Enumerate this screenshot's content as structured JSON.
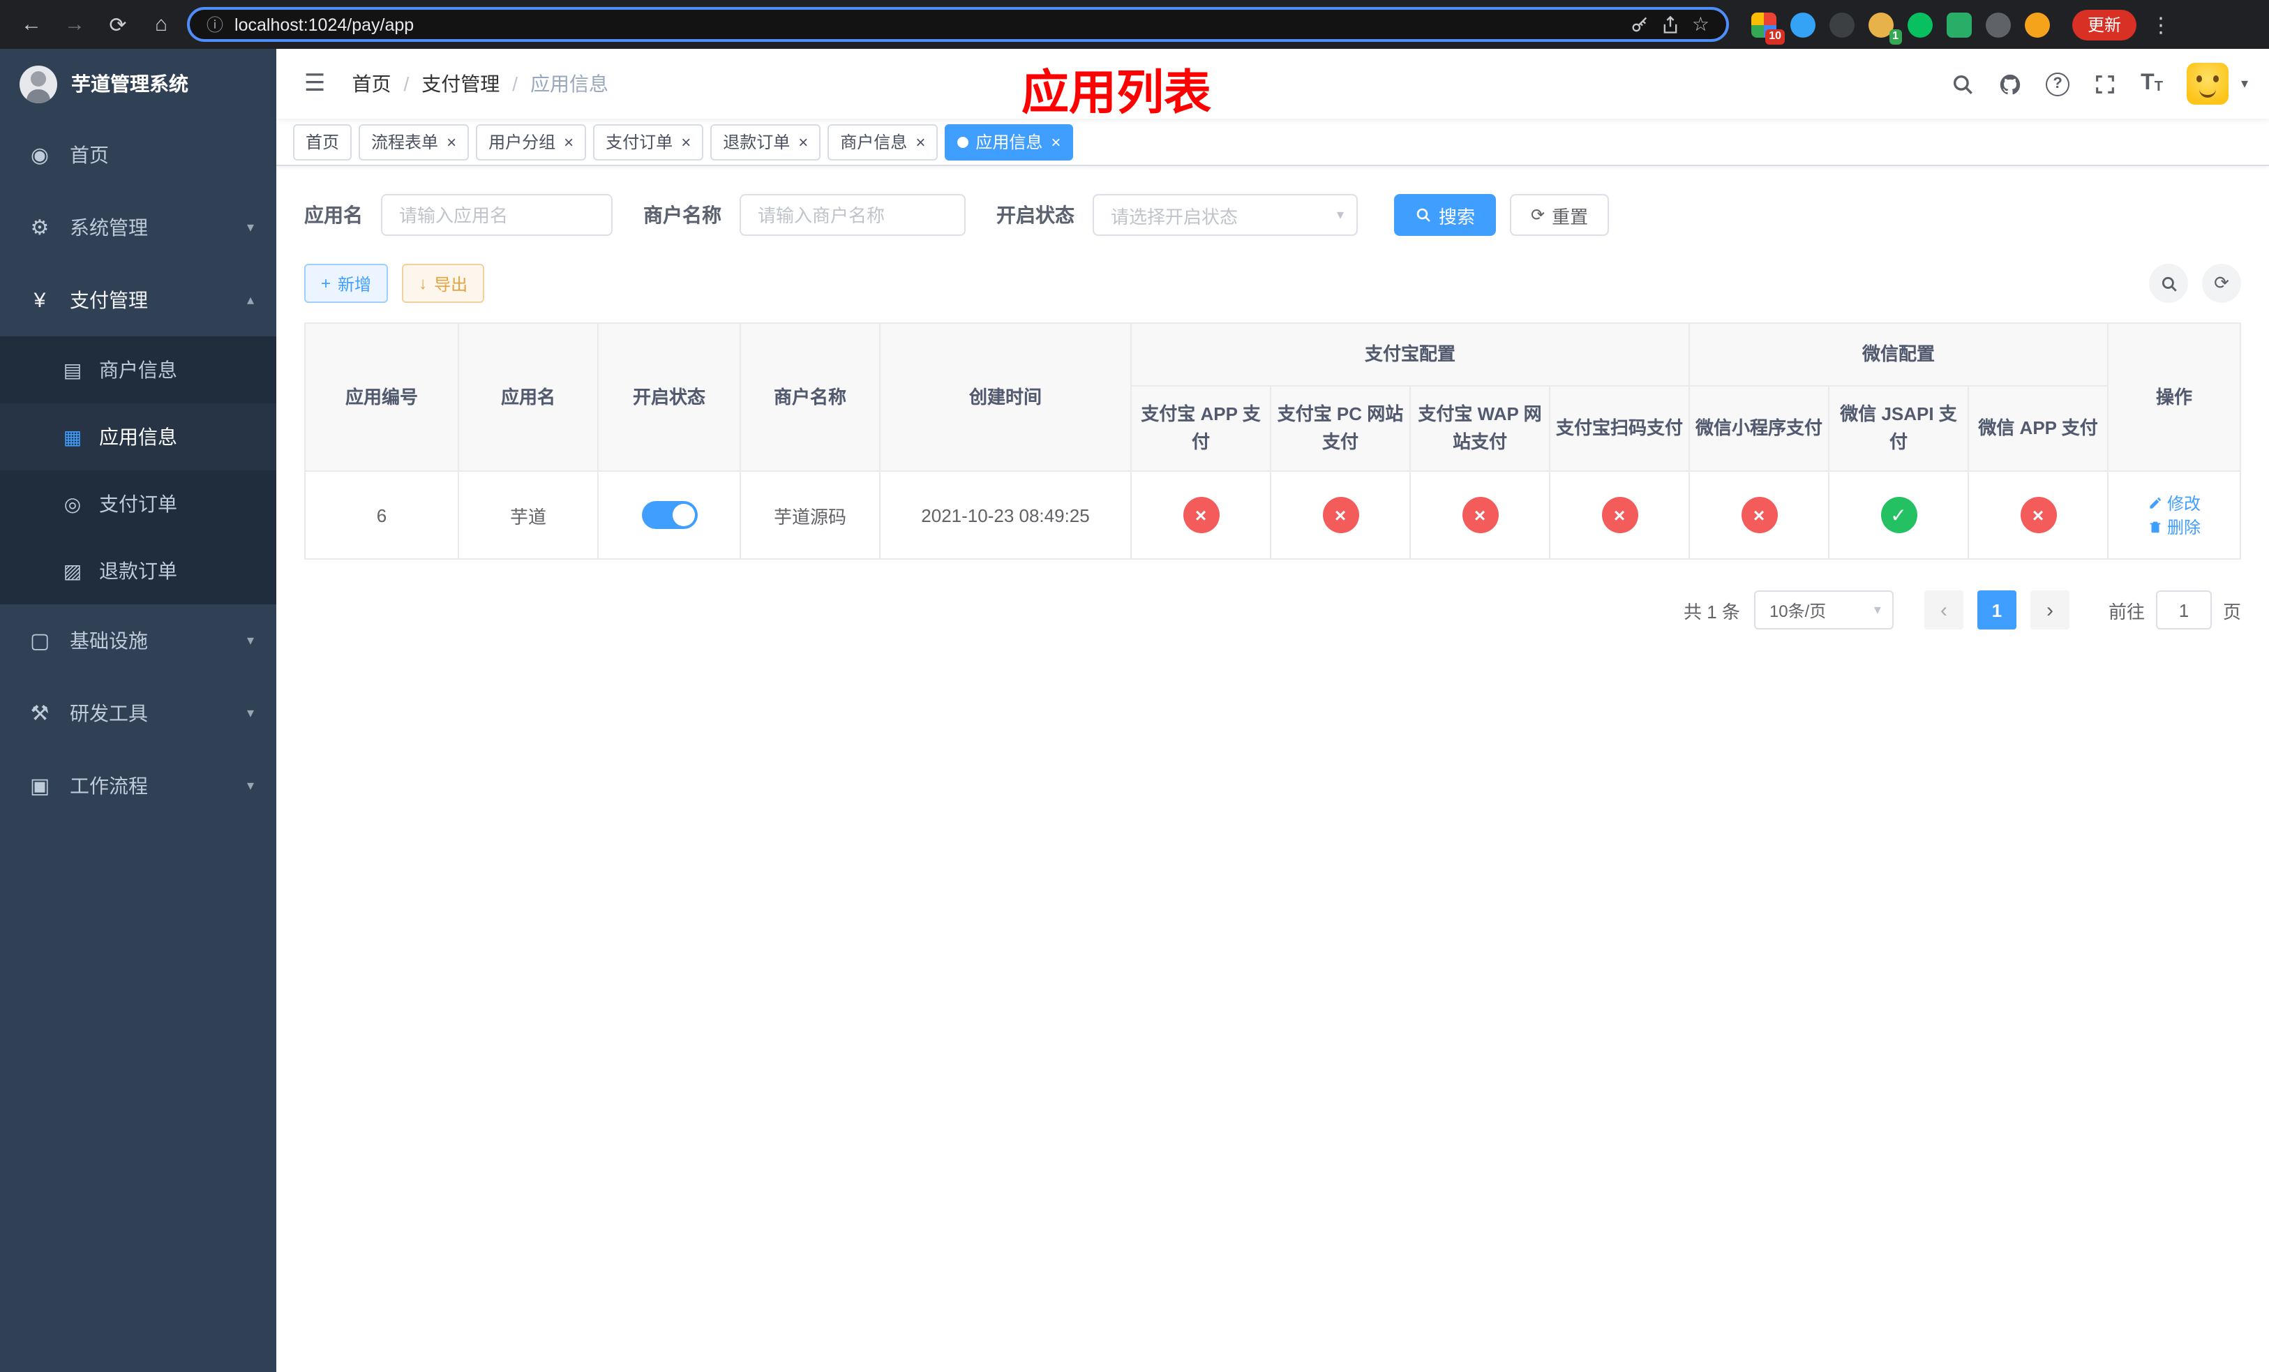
{
  "chrome": {
    "url": "localhost:1024/pay/app",
    "update_label": "更新",
    "ext_badge_grid": "10",
    "ext_badge_avatar": "1"
  },
  "icons": {
    "back": "←",
    "forward": "→",
    "reload": "⟳",
    "home": "⌂",
    "info": "ⓘ",
    "star": "☆",
    "menu_dots": "⋮",
    "hamburger": "☰",
    "caret_down": "▾",
    "caret_up": "▴",
    "close": "×",
    "prev": "‹",
    "next": "›",
    "plus": "+",
    "download": "↓",
    "refresh": "⟳",
    "question": "?",
    "font_big": "T",
    "font_small": "T",
    "menu_home": "◉",
    "menu_system": "⚙",
    "menu_pay": "¥",
    "menu_merchant": "▤",
    "menu_app": "▦",
    "menu_pay_order": "◎",
    "menu_refund": "▨",
    "menu_infra": "▢",
    "menu_devtools": "⚒",
    "menu_workflow": "▣"
  },
  "sidebar": {
    "title": "芋道管理系统",
    "items": {
      "home": "首页",
      "system": "系统管理",
      "pay": "支付管理",
      "merchant": "商户信息",
      "app": "应用信息",
      "pay_order": "支付订单",
      "refund_order": "退款订单",
      "infra": "基础设施",
      "devtools": "研发工具",
      "workflow": "工作流程"
    }
  },
  "header": {
    "breadcrumb": [
      "首页",
      "支付管理",
      "应用信息"
    ],
    "overlay_title": "应用列表"
  },
  "tabs": [
    {
      "label": "首页"
    },
    {
      "label": "流程表单"
    },
    {
      "label": "用户分组"
    },
    {
      "label": "支付订单"
    },
    {
      "label": "退款订单"
    },
    {
      "label": "商户信息"
    },
    {
      "label": "应用信息"
    }
  ],
  "filters": {
    "app_name_label": "应用名",
    "app_name_placeholder": "请输入应用名",
    "merchant_label": "商户名称",
    "merchant_placeholder": "请输入商户名称",
    "status_label": "开启状态",
    "status_placeholder": "请选择开启状态",
    "search_label": "搜索",
    "reset_label": "重置"
  },
  "toolbar": {
    "add_label": "新增",
    "export_label": "导出"
  },
  "table": {
    "groups": {
      "alipay": "支付宝配置",
      "wechat": "微信配置"
    },
    "columns": [
      "应用编号",
      "应用名",
      "开启状态",
      "商户名称",
      "创建时间",
      "支付宝 APP 支付",
      "支付宝 PC 网站支付",
      "支付宝 WAP 网站支付",
      "支付宝扫码支付",
      "微信小程序支付",
      "微信 JSAPI 支付",
      "微信 APP 支付",
      "操作"
    ],
    "rows": [
      {
        "id": "6",
        "name": "芋道",
        "status_on": true,
        "merchant": "芋道源码",
        "created": "2021-10-23 08:49:25",
        "alipay_app": false,
        "alipay_pc": false,
        "alipay_wap": false,
        "alipay_qr": false,
        "wx_mini": false,
        "wx_jsapi": true,
        "wx_app": false,
        "edit_label": "修改",
        "delete_label": "删除"
      }
    ]
  },
  "pagination": {
    "total": "共 1 条",
    "page_size": "10条/页",
    "page": "1",
    "goto_label": "前往",
    "goto_value": "1",
    "page_unit": "页"
  },
  "colors": {
    "primary": "#409eff",
    "success": "#23c161",
    "danger": "#f45c5c",
    "warning": "#e6a23c",
    "sidebar_bg": "#304156",
    "submenu_bg": "#1f2d3d",
    "annotation_red": "#fe0000"
  }
}
